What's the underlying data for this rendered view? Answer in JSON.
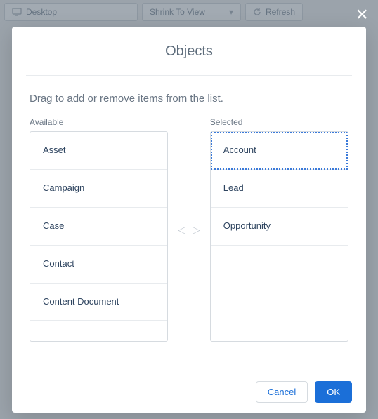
{
  "backdrop": {
    "desktop": "Desktop",
    "shrink": "Shrink To View",
    "refresh": "Refresh"
  },
  "modal": {
    "title": "Objects",
    "instruction": "Drag to add or remove items from the list.",
    "available_label": "Available",
    "selected_label": "Selected",
    "available": [
      "Asset",
      "Campaign",
      "Case",
      "Contact",
      "Content Document"
    ],
    "selected": [
      "Account",
      "Lead",
      "Opportunity"
    ],
    "active_selected_index": 0,
    "buttons": {
      "cancel": "Cancel",
      "ok": "OK"
    }
  }
}
